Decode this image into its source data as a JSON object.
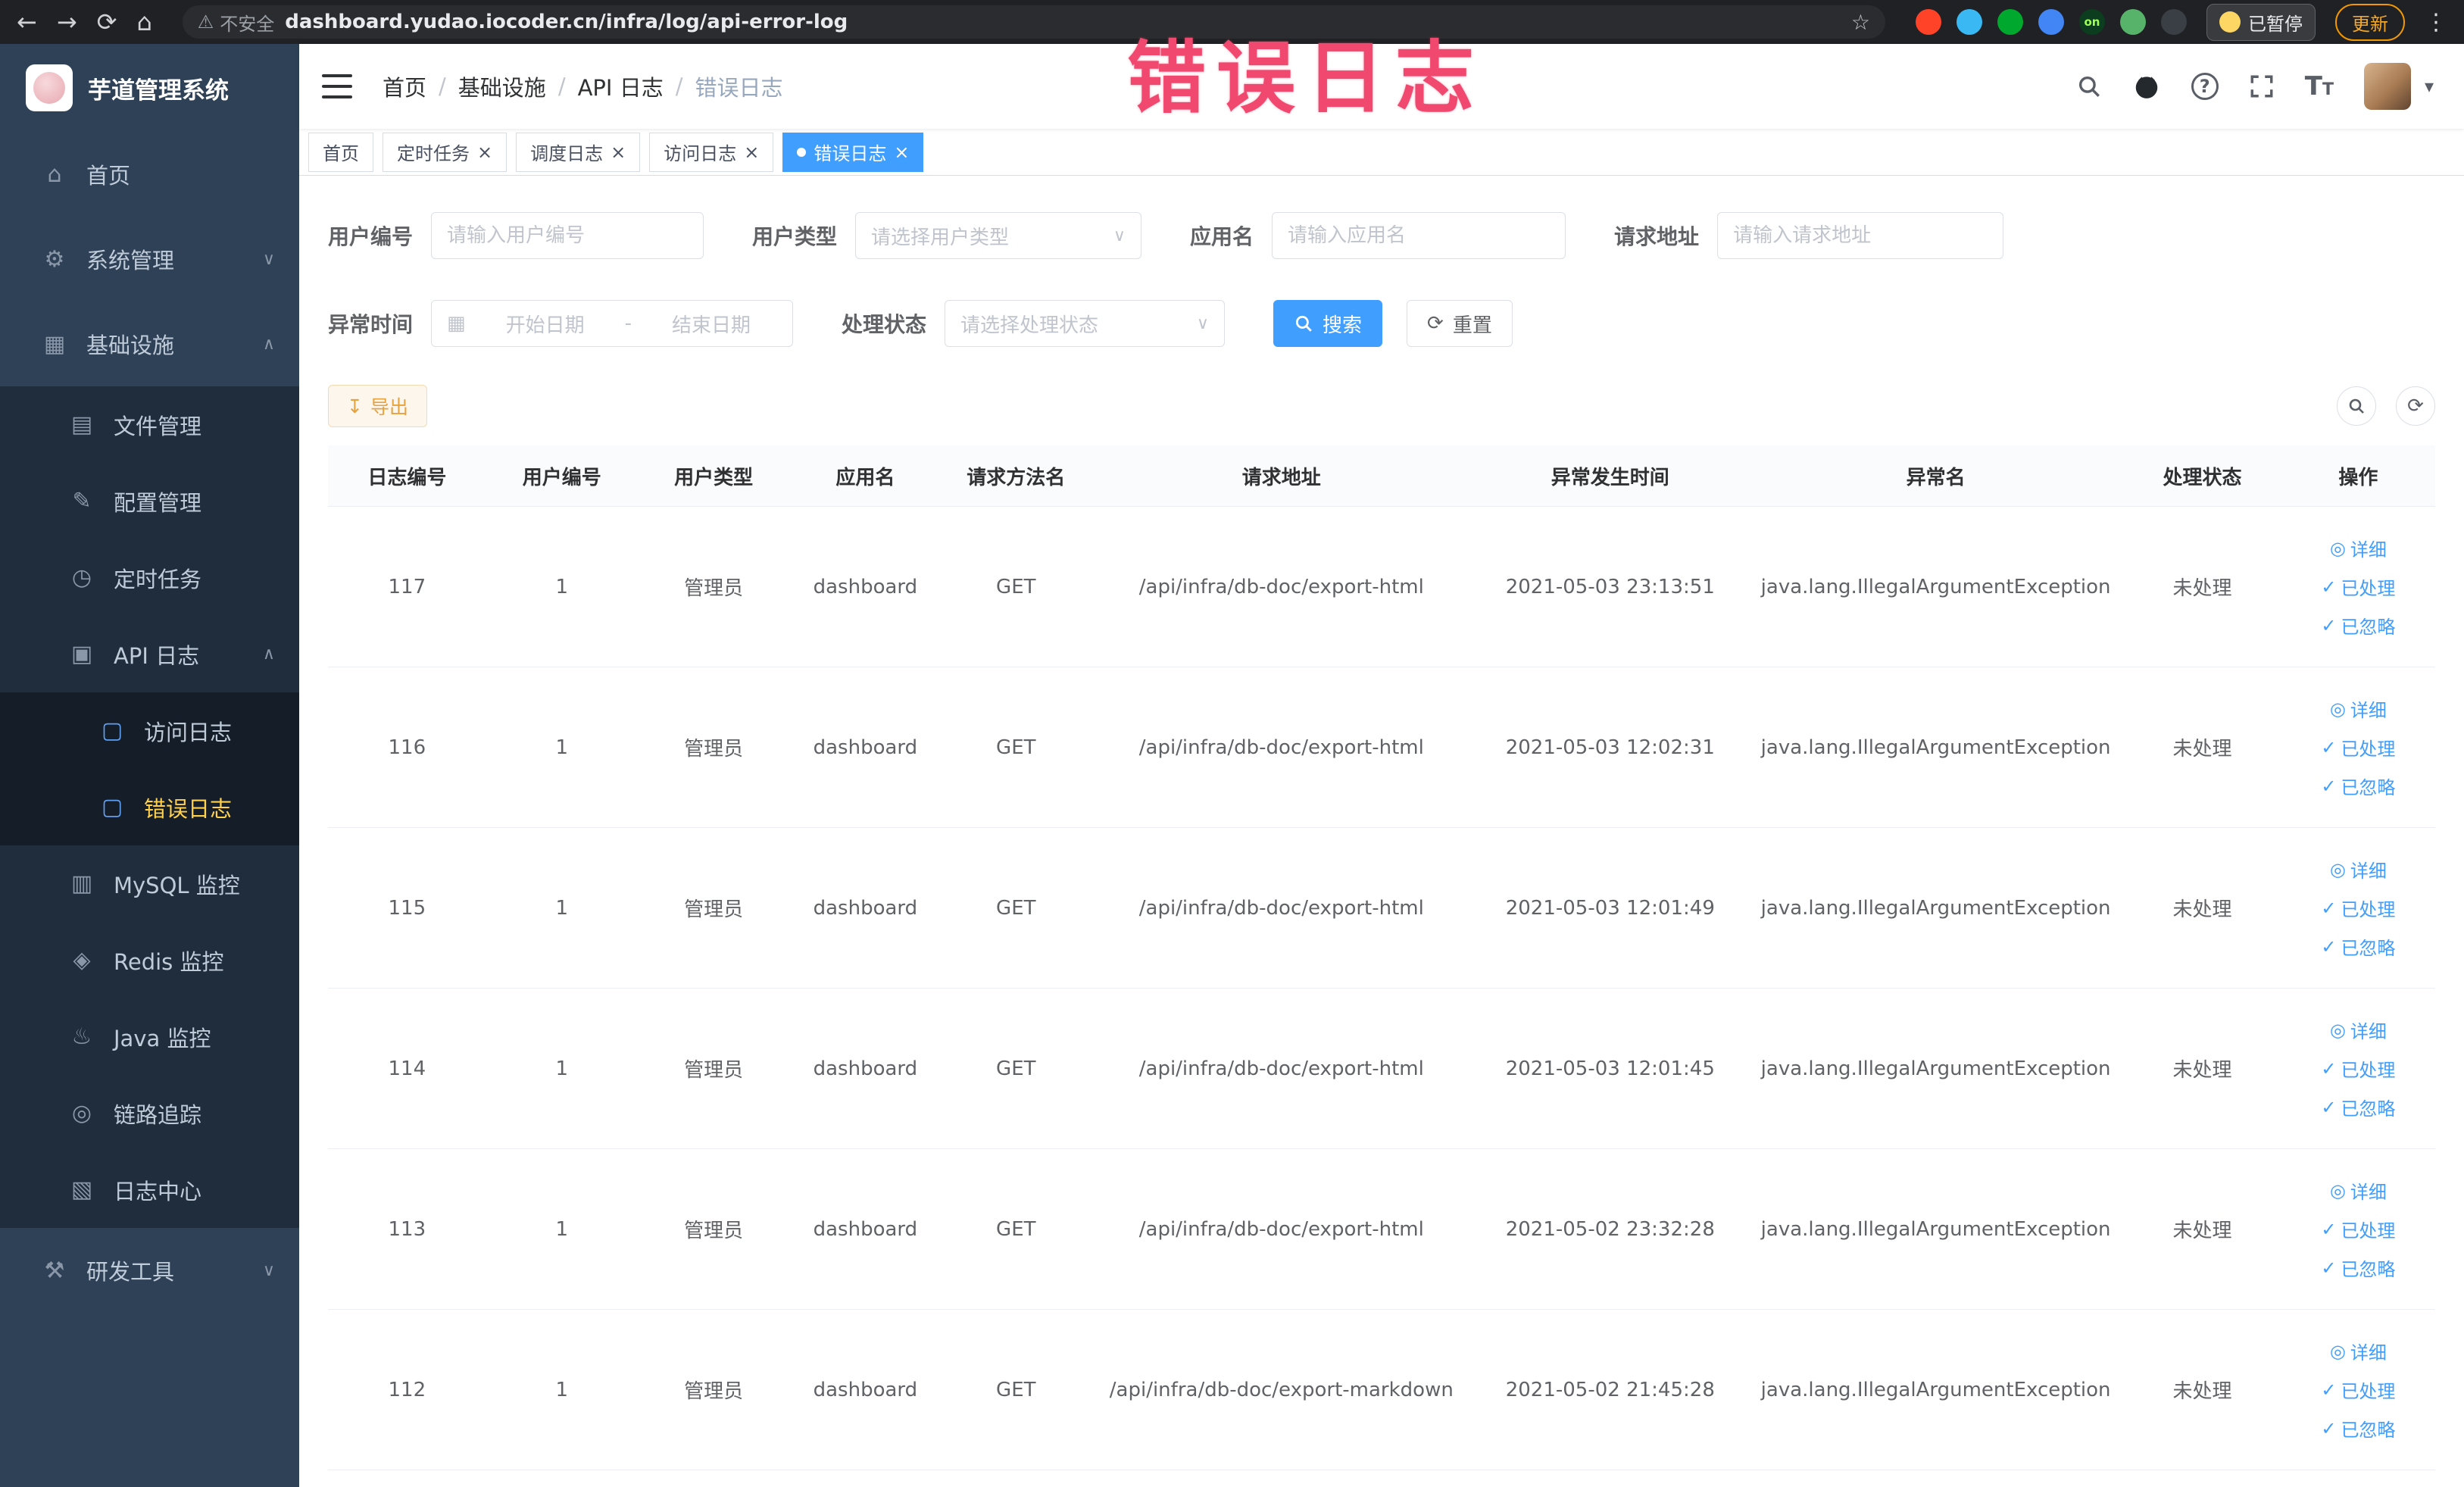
{
  "annotation": {
    "text": "错误日志",
    "color": "#f0486e"
  },
  "colors": {
    "accent": "#409eff",
    "sidebar_bg": "#2f4156",
    "submenu_bg": "#1f2d3d",
    "active_menu_text": "#ffd04b",
    "warning": "#e6a23c",
    "annotation_pink": "#f0486e"
  },
  "ui": {
    "back": "←",
    "forward": "→",
    "reload": "⟳",
    "home": "⌂",
    "warning": "⚠",
    "star": "☆",
    "dots": "⋮",
    "caret": "▾",
    "close_glyph": "×",
    "eye_glyph": "◎",
    "check_glyph": "✓",
    "refresh_glyph": "⟳",
    "download_glyph": "↧",
    "calendar_glyph": "▦",
    "question_glyph": "?",
    "fontsize_glyph_big": "T",
    "fontsize_glyph_small": "T",
    "select_arrow": "∨"
  },
  "browser": {
    "security_label": "不安全",
    "url": "dashboard.yudao.iocoder.cn/infra/log/api-error-log",
    "paused_label": "已暂停",
    "update_label": "更新",
    "extensions": [
      {
        "icon_name": "ext-adblock-icon",
        "color": "#ff4329"
      },
      {
        "icon_name": "ext-drop-icon",
        "color": "#39b8f3"
      },
      {
        "icon_name": "ext-evernote-icon",
        "color": "#00a82d"
      },
      {
        "icon_name": "ext-grid-icon",
        "color": "#4285f4"
      },
      {
        "icon_name": "ext-on-badge-icon",
        "color": "#0b3d1e",
        "label": "on"
      },
      {
        "icon_name": "ext-sprout-icon",
        "color": "#57b36a"
      },
      {
        "icon_name": "ext-paw-icon",
        "color": "#3a3f45"
      }
    ]
  },
  "sidebar": {
    "logo_title": "芋道管理系统",
    "items": [
      {
        "label": "首页",
        "cls": "l1",
        "icon": "⌂",
        "icon_name": "home-icon"
      },
      {
        "label": "系统管理",
        "cls": "l1",
        "icon": "⚙",
        "icon_name": "gear-icon",
        "chevron": "∨"
      },
      {
        "label": "基础设施",
        "cls": "l1",
        "icon": "▦",
        "icon_name": "grid-icon",
        "chevron": "∧"
      },
      {
        "label": "文件管理",
        "cls": "l2",
        "icon": "▤",
        "icon_name": "folder-icon"
      },
      {
        "label": "配置管理",
        "cls": "l2",
        "icon": "✎",
        "icon_name": "edit-icon"
      },
      {
        "label": "定时任务",
        "cls": "l2",
        "icon": "◷",
        "icon_name": "timer-icon"
      },
      {
        "label": "API 日志",
        "cls": "l2",
        "icon": "▣",
        "icon_name": "api-log-icon",
        "chevron": "∧"
      },
      {
        "label": "访问日志",
        "cls": "l3",
        "icon": "▢",
        "icon_name": "access-log-icon"
      },
      {
        "label": "错误日志",
        "cls": "l3 active",
        "icon": "▢",
        "icon_name": "error-log-icon"
      },
      {
        "label": "MySQL 监控",
        "cls": "l2",
        "icon": "▥",
        "icon_name": "mysql-icon"
      },
      {
        "label": "Redis 监控",
        "cls": "l2",
        "icon": "◈",
        "icon_name": "redis-icon"
      },
      {
        "label": "Java 监控",
        "cls": "l2",
        "icon": "♨",
        "icon_name": "java-icon"
      },
      {
        "label": "链路追踪",
        "cls": "l2",
        "icon": "◎",
        "icon_name": "trace-icon"
      },
      {
        "label": "日志中心",
        "cls": "l2",
        "icon": "▧",
        "icon_name": "log-center-icon"
      },
      {
        "label": "研发工具",
        "cls": "l1",
        "icon": "⚒",
        "icon_name": "tools-icon",
        "chevron": "∨"
      }
    ]
  },
  "header": {
    "breadcrumb": [
      {
        "label": "首页"
      },
      {
        "sep": "/",
        "label": "基础设施"
      },
      {
        "sep": "/",
        "label": "API 日志"
      },
      {
        "sep": "/",
        "label": "错误日志",
        "cls": "last"
      }
    ]
  },
  "tabs": [
    {
      "label": "首页"
    },
    {
      "label": "定时任务",
      "closable": true
    },
    {
      "label": "调度日志",
      "closable": true
    },
    {
      "label": "访问日志",
      "closable": true
    },
    {
      "label": "错误日志",
      "closable": true,
      "active": true,
      "cls": "active"
    }
  ],
  "filters": {
    "user_id": {
      "label": "用户编号",
      "placeholder": "请输入用户编号"
    },
    "user_type": {
      "label": "用户类型",
      "placeholder": "请选择用户类型"
    },
    "app_name": {
      "label": "应用名",
      "placeholder": "请输入应用名"
    },
    "request_url": {
      "label": "请求地址",
      "placeholder": "请输入请求地址"
    },
    "exception_time": {
      "label": "异常时间",
      "start_placeholder": "开始日期",
      "end_placeholder": "结束日期",
      "range_separator": "-"
    },
    "process_status": {
      "label": "处理状态",
      "placeholder": "请选择处理状态"
    },
    "search_label": "搜索",
    "reset_label": "重置"
  },
  "toolbar": {
    "export_label": "导出"
  },
  "table": {
    "columns": [
      {
        "label": "日志编号"
      },
      {
        "label": "用户编号"
      },
      {
        "label": "用户类型"
      },
      {
        "label": "应用名"
      },
      {
        "label": "请求方法名"
      },
      {
        "label": "请求地址"
      },
      {
        "label": "异常发生时间"
      },
      {
        "label": "异常名"
      },
      {
        "label": "处理状态"
      },
      {
        "label": "操作"
      }
    ],
    "actions": {
      "detail": "详细",
      "processed": "已处理",
      "ignored": "已忽略"
    },
    "rows": [
      {
        "id": "117",
        "user_id": "1",
        "user_type": "管理员",
        "app": "dashboard",
        "method": "GET",
        "url": "/api/infra/db-doc/export-html",
        "time": "2021-05-03 23:13:51",
        "exception": "java.lang.IllegalArgumentException",
        "status": "未处理"
      },
      {
        "id": "116",
        "user_id": "1",
        "user_type": "管理员",
        "app": "dashboard",
        "method": "GET",
        "url": "/api/infra/db-doc/export-html",
        "time": "2021-05-03 12:02:31",
        "exception": "java.lang.IllegalArgumentException",
        "status": "未处理"
      },
      {
        "id": "115",
        "user_id": "1",
        "user_type": "管理员",
        "app": "dashboard",
        "method": "GET",
        "url": "/api/infra/db-doc/export-html",
        "time": "2021-05-03 12:01:49",
        "exception": "java.lang.IllegalArgumentException",
        "status": "未处理"
      },
      {
        "id": "114",
        "user_id": "1",
        "user_type": "管理员",
        "app": "dashboard",
        "method": "GET",
        "url": "/api/infra/db-doc/export-html",
        "time": "2021-05-03 12:01:45",
        "exception": "java.lang.IllegalArgumentException",
        "status": "未处理"
      },
      {
        "id": "113",
        "user_id": "1",
        "user_type": "管理员",
        "app": "dashboard",
        "method": "GET",
        "url": "/api/infra/db-doc/export-html",
        "time": "2021-05-02 23:32:28",
        "exception": "java.lang.IllegalArgumentException",
        "status": "未处理"
      },
      {
        "id": "112",
        "user_id": "1",
        "user_type": "管理员",
        "app": "dashboard",
        "method": "GET",
        "url": "/api/infra/db-doc/export-markdown",
        "time": "2021-05-02 21:45:28",
        "exception": "java.lang.IllegalArgumentException",
        "status": "未处理"
      }
    ]
  }
}
